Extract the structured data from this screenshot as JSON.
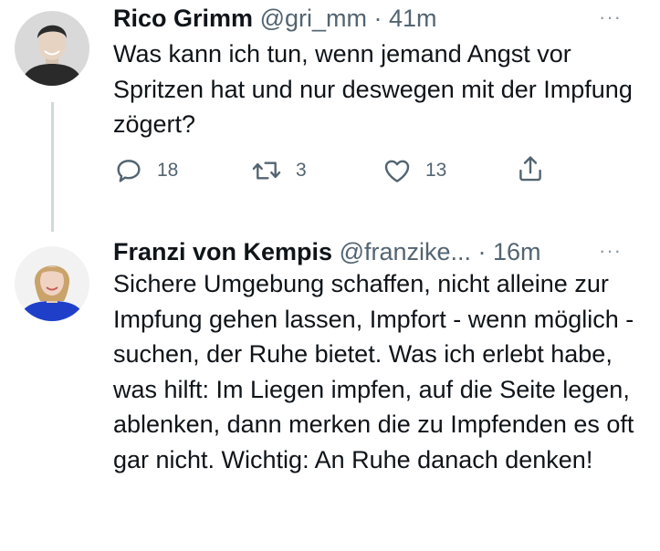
{
  "tweets": [
    {
      "name": "Rico Grimm",
      "handle": "@gri_mm",
      "time": "· 41m",
      "text": "Was kann ich tun, wenn jemand Angst vor Spritzen hat und nur deswegen mit der Impfung zögert?",
      "replies": "18",
      "retweets": "3",
      "likes": "13",
      "more": "···"
    },
    {
      "name": "Franzi von Kempis",
      "handle": "@franzike...",
      "time": "· 16m",
      "text": "Sichere Umgebung schaffen, nicht alleine zur Impfung gehen lassen, Impfort - wenn möglich - suchen, der Ruhe bietet. Was ich erlebt habe, was hilft: Im Liegen impfen, auf die Seite legen, ablenken, dann merken die zu Impfenden es oft gar nicht. Wichtig: An Ruhe danach denken!",
      "more": "···"
    }
  ],
  "icons": [
    "reply-icon",
    "retweet-icon",
    "like-icon",
    "share-icon"
  ],
  "colors": {
    "text": "#0f1419",
    "secondary": "#536471",
    "thread_line": "#cfd9de"
  }
}
